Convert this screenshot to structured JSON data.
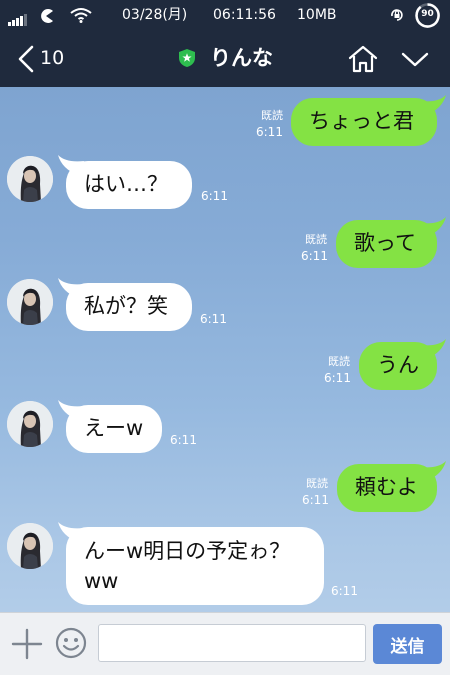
{
  "status_bar": {
    "date": "03/28(月)",
    "time": "06:11:56",
    "data_usage": "10MB",
    "battery_level": "90"
  },
  "nav": {
    "back_count": "10",
    "title": "りんな"
  },
  "messages": [
    {
      "side": "right",
      "text": "ちょっと君",
      "read": "既読",
      "time": "6:11"
    },
    {
      "side": "left",
      "text": "はい…？",
      "time": "6:11"
    },
    {
      "side": "right",
      "text": "歌って",
      "read": "既読",
      "time": "6:11"
    },
    {
      "side": "left",
      "text": "私が？笑",
      "time": "6:11"
    },
    {
      "side": "right",
      "text": "うん",
      "read": "既読",
      "time": "6:11"
    },
    {
      "side": "left",
      "text": "えーw",
      "time": "6:11"
    },
    {
      "side": "right",
      "text": "頼むよ",
      "read": "既読",
      "time": "6:11"
    },
    {
      "side": "left",
      "text": "んーw明日の予定ゎ？ww",
      "time": "6:11"
    }
  ],
  "input_bar": {
    "placeholder": "",
    "send_label": "送信"
  },
  "colors": {
    "header": "#1f2a3d",
    "my_bubble": "#84e244",
    "their_bubble": "#ffffff",
    "send_button": "#5b88d6",
    "verified_badge": "#2ebd4f"
  }
}
